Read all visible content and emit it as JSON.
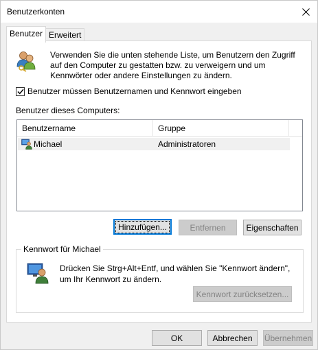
{
  "window": {
    "title": "Benutzerkonten",
    "close_icon": "close-icon"
  },
  "tabs": [
    {
      "label": "Benutzer",
      "active": true
    },
    {
      "label": "Erweitert",
      "active": false
    }
  ],
  "intro": {
    "text": "Verwenden Sie die unten stehende Liste, um Benutzern den Zugriff auf den Computer zu gestatten bzw. zu verweigern und um Kennwörter oder andere Einstellungen zu ändern.",
    "icon": "users-keys-icon"
  },
  "require_login": {
    "label": "Benutzer müssen Benutzernamen und Kennwort eingeben",
    "checked": true
  },
  "users_list": {
    "label": "Benutzer dieses Computers:",
    "columns": [
      "Benutzername",
      "Gruppe"
    ],
    "rows": [
      {
        "name": "Michael",
        "group": "Administratoren",
        "icon": "user-admin-icon"
      }
    ]
  },
  "list_buttons": {
    "add": "Hinzufügen...",
    "remove": "Entfernen",
    "properties": "Eigenschaften"
  },
  "password_group": {
    "legend": "Kennwort für Michael",
    "text": "Drücken Sie Strg+Alt+Entf, und wählen Sie \"Kennwort ändern\", um Ihr Kennwort zu ändern.",
    "reset_button": "Kennwort zurücksetzen...",
    "icon": "user-monitor-icon"
  },
  "footer": {
    "ok": "OK",
    "cancel": "Abbrechen",
    "apply": "Übernehmen"
  },
  "colors": {
    "accent": "#0078d7",
    "panel": "#ffffff",
    "window": "#f0f0f0"
  }
}
